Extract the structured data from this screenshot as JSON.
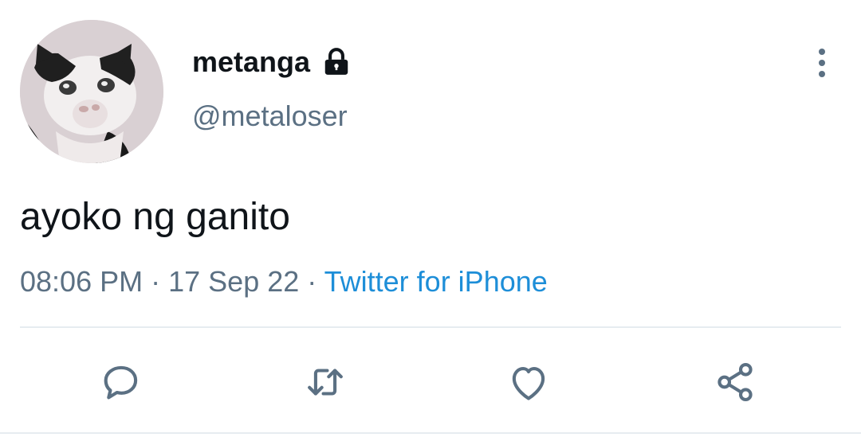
{
  "user": {
    "display_name": "metanga",
    "handle": "@metaloser",
    "avatar_icon": "cat-avatar",
    "protected_icon": "lock-icon"
  },
  "tweet": {
    "text": "ayoko ng ganito"
  },
  "meta": {
    "time": "08:06 PM",
    "separator": "·",
    "date": "17 Sep 22",
    "source": "Twitter for iPhone"
  },
  "actions": [
    {
      "icon": "reply-icon"
    },
    {
      "icon": "retweet-icon"
    },
    {
      "icon": "like-icon"
    },
    {
      "icon": "share-icon"
    }
  ],
  "menu": {
    "icon": "more-vertical-icon"
  },
  "colors": {
    "text": "#0f1419",
    "secondary": "#5b7083",
    "link": "#1d8ed8",
    "icon": "#5b7083",
    "divider": "#e6ecf0"
  }
}
